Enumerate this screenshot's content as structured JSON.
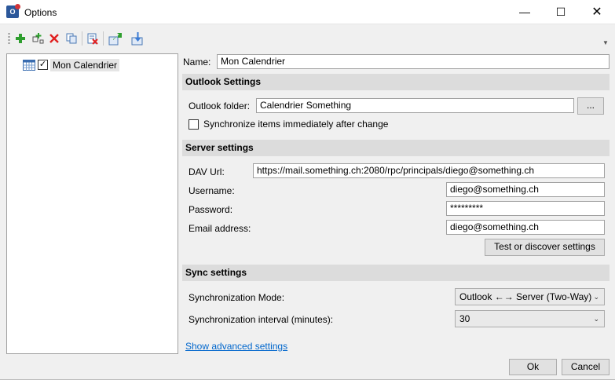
{
  "window": {
    "title": "Options",
    "minimize": "—",
    "maximize": "☐",
    "close": "✕"
  },
  "icons": {
    "add": "plus-icon",
    "add_multiple": "add-multiple-icon",
    "delete": "delete-icon",
    "copy": "copy-icon",
    "clear_cache": "clear-cache-icon",
    "export": "export-icon",
    "import": "import-icon"
  },
  "tree": {
    "items": [
      {
        "label": "Mon Calendrier",
        "checked": "✓"
      }
    ]
  },
  "profile": {
    "name_label": "Name:",
    "name_value": "Mon Calendrier"
  },
  "outlook": {
    "section_title": "Outlook Settings",
    "folder_label": "Outlook folder:",
    "folder_value": "Calendrier Something",
    "browse_label": "...",
    "sync_immediately_label": "Synchronize items immediately after change"
  },
  "server": {
    "section_title": "Server settings",
    "dav_url_label": "DAV Url:",
    "dav_url_value": "https://mail.something.ch:2080/rpc/principals/diego@something.ch",
    "username_label": "Username:",
    "username_value": "diego@something.ch",
    "password_label": "Password:",
    "password_value": "*********",
    "email_label": "Email address:",
    "email_value": "diego@something.ch",
    "test_button": "Test or discover settings"
  },
  "sync": {
    "section_title": "Sync settings",
    "mode_label": "Synchronization Mode:",
    "mode_value": "Outlook ←→ Server (Two-Way)",
    "interval_label": "Synchronization interval (minutes):",
    "interval_value": "30",
    "advanced_link": "Show advanced settings"
  },
  "footer": {
    "ok": "Ok",
    "cancel": "Cancel"
  },
  "colors": {
    "section_bg": "#dcdcdc",
    "link": "#0066cc",
    "accent": "#2b579a"
  }
}
